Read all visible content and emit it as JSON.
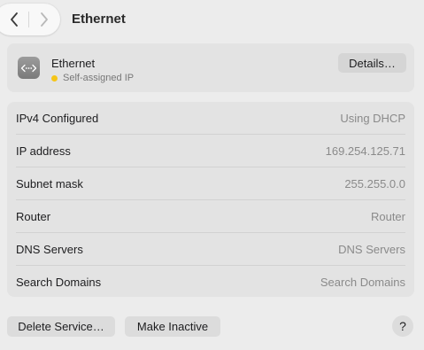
{
  "window": {
    "title": "Ethernet"
  },
  "toolbar": {
    "back_icon": "chevron-left",
    "forward_icon": "chevron-right"
  },
  "service": {
    "icon": "ethernet-arrows-icon",
    "name": "Ethernet",
    "status_text": "Self-assigned IP",
    "status_color": "#f5c518",
    "details_label": "Details…"
  },
  "info": {
    "rows": [
      {
        "label": "IPv4 Configured",
        "value": "Using DHCP"
      },
      {
        "label": "IP address",
        "value": "169.254.125.71"
      },
      {
        "label": "Subnet mask",
        "value": "255.255.0.0"
      },
      {
        "label": "Router",
        "value": "Router"
      },
      {
        "label": "DNS Servers",
        "value": "DNS Servers"
      },
      {
        "label": "Search Domains",
        "value": "Search Domains"
      }
    ]
  },
  "footer": {
    "delete_label": "Delete Service…",
    "inactive_label": "Make Inactive",
    "help_label": "?"
  }
}
